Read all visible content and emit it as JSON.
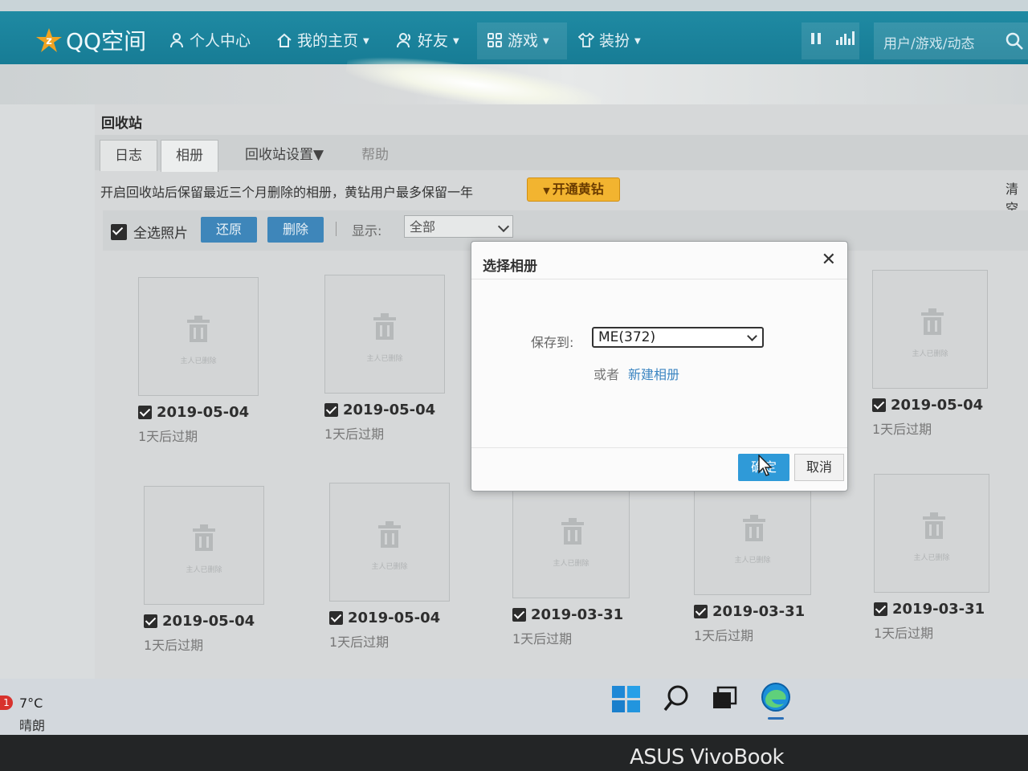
{
  "header": {
    "logo_text": "QQ空间",
    "nav": [
      {
        "label": "个人中心",
        "icon": "person-icon"
      },
      {
        "label": "我的主页",
        "icon": "home-icon"
      },
      {
        "label": "好友",
        "icon": "friends-icon"
      },
      {
        "label": "游戏",
        "icon": "games-grid-icon"
      },
      {
        "label": "装扮",
        "icon": "shirt-icon"
      }
    ],
    "search_placeholder": "用户/游戏/动态"
  },
  "recycle_bin": {
    "title": "回收站",
    "tabs": [
      "日志",
      "相册",
      "回收站设置▼",
      "帮助"
    ],
    "active_tab": "相册",
    "notice": "开启回收站后保留最近三个月删除的相册，黄钻用户最多保留一年",
    "vip_button": "开通黄钻",
    "clear_label": "清空",
    "select_all_label": "全选照片",
    "restore_button": "还原",
    "delete_button": "删除",
    "display_label": "显示:",
    "display_value": "全部",
    "thumb_caption": "主人已删除",
    "photos": [
      {
        "date": "2019-05-04",
        "expiry": "1天后过期",
        "checked": true
      },
      {
        "date": "2019-05-04",
        "expiry": "1天后过期",
        "checked": true
      },
      {
        "date": "2019-05-04",
        "expiry": "1天后过期",
        "checked": true
      },
      {
        "date": "2019-05-04",
        "expiry": "1天后过期",
        "checked": true
      },
      {
        "date": "2019-05-04",
        "expiry": "1天后过期",
        "checked": true
      },
      {
        "date": "2019-03-31",
        "expiry": "1天后过期",
        "checked": true
      },
      {
        "date": "2019-03-31",
        "expiry": "1天后过期",
        "checked": true
      },
      {
        "date": "2019-03-31",
        "expiry": "1天后过期",
        "checked": true
      }
    ]
  },
  "dialog": {
    "title": "选择相册",
    "save_to_label": "保存到:",
    "album_value": "ME(372)",
    "or_text": "或者",
    "new_album_link": "新建相册",
    "ok_button": "确定",
    "cancel_button": "取消"
  },
  "taskbar": {
    "weather_badge": "1",
    "temperature": "7°C",
    "condition": "晴朗"
  },
  "laptop_brand": "ASUS VivoBook",
  "colors": {
    "nav_bar": "#1a83a0",
    "primary_button": "#3e86ba",
    "ok_button": "#2f9ad8",
    "vip_button": "#f2b430",
    "link": "#3c86c2"
  }
}
